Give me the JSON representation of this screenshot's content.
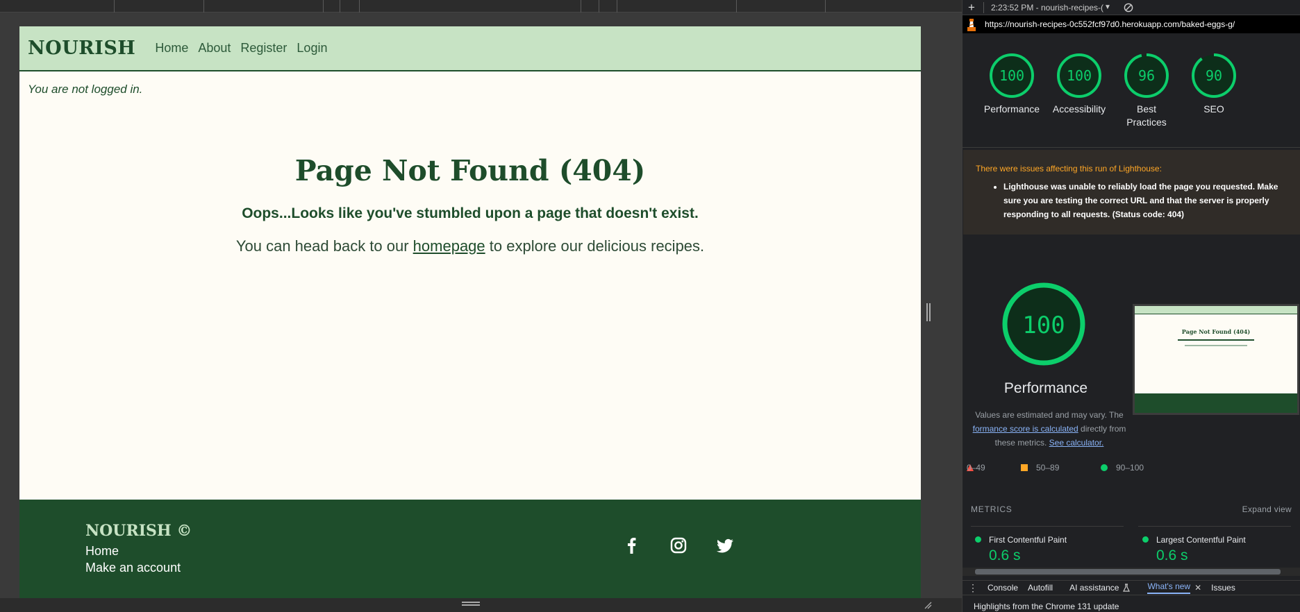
{
  "site": {
    "brand": "NOURISH",
    "nav": [
      "Home",
      "About",
      "Register",
      "Login"
    ],
    "login_status": "You are not logged in.",
    "title": "Page Not Found (404)",
    "subtitle": "Oops...Looks like you've stumbled upon a page that doesn't exist.",
    "body_before": "You can head back to our ",
    "body_link": "homepage",
    "body_after": " to explore our delicious recipes.",
    "footer": {
      "brand": "NOURISH ©",
      "home": "Home",
      "account": "Make an account"
    },
    "social_icons": [
      "facebook-icon",
      "instagram-icon",
      "twitter-icon"
    ],
    "colors": {
      "nav_bg": "#c7e3c4",
      "dark_green": "#1e4d2b",
      "page_bg": "#fefcf5"
    }
  },
  "devtools": {
    "report_time": "2:23:52 PM - nourish-recipes-(",
    "url": "https://nourish-recipes-0c552fcf97d0.herokuapp.com/baked-eggs-g/",
    "scores": [
      {
        "value": "100",
        "label": "Performance",
        "score": 100
      },
      {
        "value": "100",
        "label": "Accessibility",
        "score": 100
      },
      {
        "value": "96",
        "label": "Best Practices",
        "score": 96
      },
      {
        "value": "90",
        "label": "SEO",
        "score": 90
      }
    ],
    "warning_title": "There were issues affecting this run of Lighthouse:",
    "warning_item": "Lighthouse was unable to reliably load the page you requested. Make sure you are testing the correct URL and that the server is properly responding to all requests. (Status code: 404)",
    "perf_score": "100",
    "perf_label": "Performance",
    "perf_note_1": "Values are estimated and may vary. The ",
    "perf_note_link": "formance score is calculated",
    "perf_note_2": " directly from these metrics. ",
    "perf_note_link2": "See calculator.",
    "legend": [
      "0–49",
      "50–89",
      "90–100"
    ],
    "metrics_header": "METRICS",
    "expand_view": "Expand view",
    "metrics": [
      {
        "name": "First Contentful Paint",
        "value": "0.6 s"
      },
      {
        "name": "Largest Contentful Paint",
        "value": "0.6 s"
      }
    ],
    "drawer_tabs": [
      "Console",
      "Autofill",
      "AI assistance",
      "What's new",
      "Issues"
    ],
    "drawer_text": "Highlights from the Chrome 131 update",
    "accent_green": "#0cce6b",
    "accent_orange": "#ffa726"
  }
}
